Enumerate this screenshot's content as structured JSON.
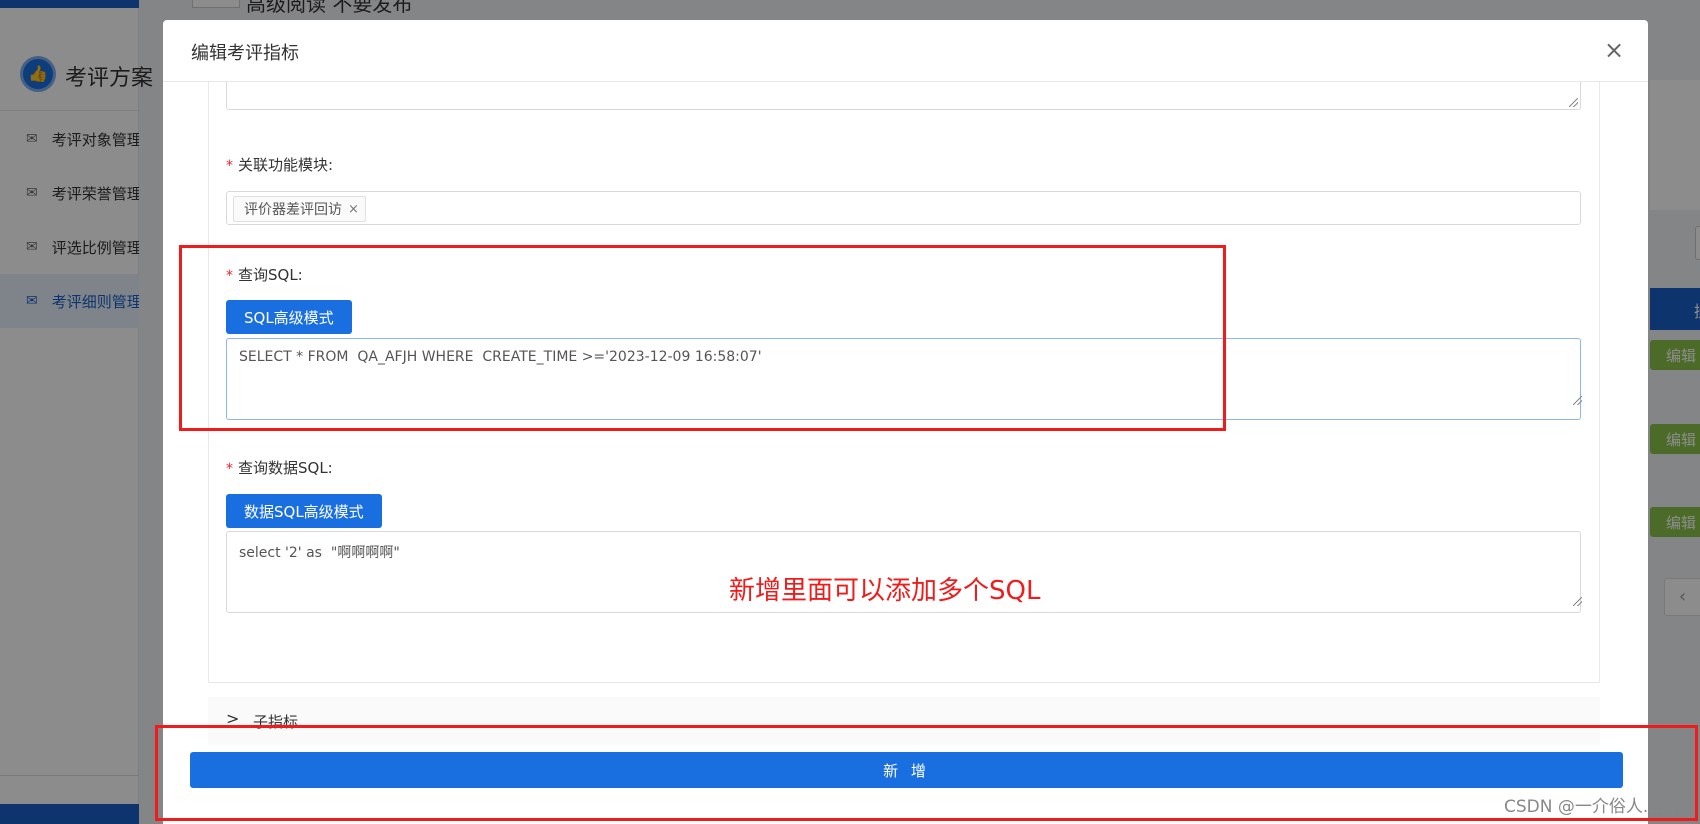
{
  "background_app": {
    "app_title": "考评方案",
    "top_partial_text": "高级阅读 不要发布",
    "menu_items": [
      {
        "label": "考评对象管理",
        "icon": "mail-icon"
      },
      {
        "label": "考评荣誉管理",
        "icon": "mail-icon"
      },
      {
        "label": "评选比例管理",
        "icon": "mail-icon"
      },
      {
        "label": "考评细则管理",
        "icon": "mail-icon",
        "active": true
      }
    ],
    "right_header_text": "操",
    "edit_label": "编辑",
    "pager_prev": "‹"
  },
  "modal": {
    "title": "编辑考评指标",
    "close_glyph": "×",
    "fields": {
      "module": {
        "label": "关联功能模块:",
        "required_mark": "*",
        "tags": [
          {
            "label": "评价器差评回访",
            "remove_glyph": "×"
          }
        ]
      },
      "query_sql": {
        "label": "查询SQL:",
        "required_mark": "*",
        "mode_button": "SQL高级模式",
        "value": "SELECT * FROM  QA_AFJH WHERE  CREATE_TIME >='2023-12-09 16:58:07'"
      },
      "data_sql": {
        "label": "查询数据SQL:",
        "required_mark": "*",
        "mode_button": "数据SQL高级模式",
        "value": "select '2' as  \"啊啊啊啊\""
      }
    },
    "sub_indicator": {
      "arrow": ">",
      "label": "子指标"
    },
    "submit_button": "新 增"
  },
  "annotation": {
    "text": "新增里面可以添加多个SQL",
    "color": "#f01c1c"
  },
  "watermark": "CSDN @一介俗人......",
  "colors": {
    "primary": "#1a6fe0",
    "required": "#f5222d",
    "edit_button": "#8bc34a"
  }
}
